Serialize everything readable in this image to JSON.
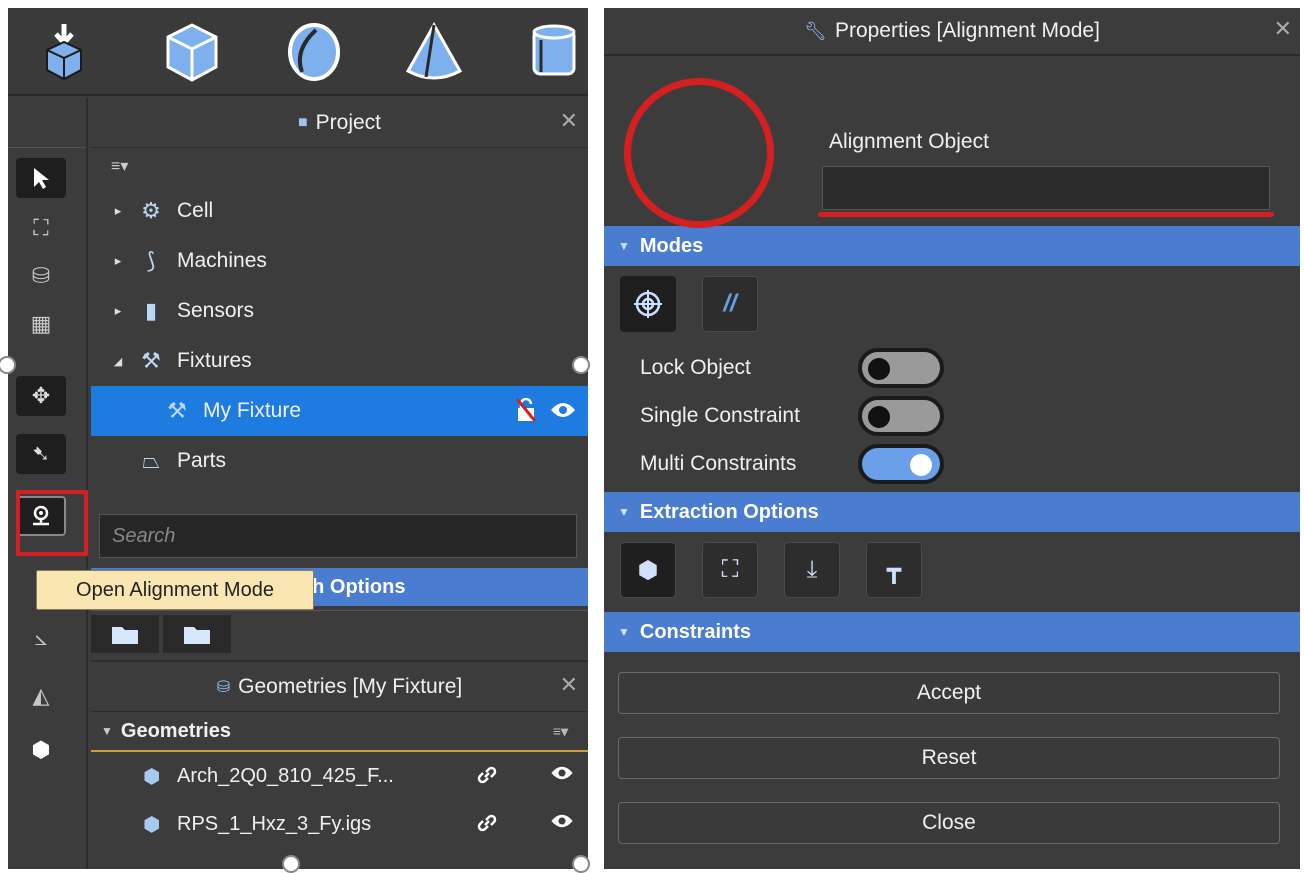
{
  "shape_toolbar": {
    "icons": [
      "import-part-icon",
      "box-icon",
      "sphere-icon",
      "cone-icon",
      "cylinder-icon"
    ]
  },
  "vertical_toolbar": {
    "icons": [
      "select-arrow-icon",
      "fixture-icon",
      "parts-stack-icon",
      "grid-icon",
      "robot-jog-icon",
      "robot-teach-icon",
      "alignment-pin-icon",
      "frame-icon",
      "measure-icon",
      "geometry-icon"
    ]
  },
  "project_panel": {
    "title": "Project",
    "menu": "≡▾",
    "tree": [
      {
        "label": "Cell",
        "caret": "▸",
        "icon": "cell-icon"
      },
      {
        "label": "Machines",
        "caret": "▸",
        "icon": "robot-arm-icon"
      },
      {
        "label": "Sensors",
        "caret": "▸",
        "icon": "sensor-icon"
      },
      {
        "label": "Fixtures",
        "caret": "◢",
        "icon": "fixture-icon"
      },
      {
        "label": "My Fixture",
        "caret": "",
        "icon": "fixture-icon",
        "selected": true
      },
      {
        "label": "Parts",
        "caret": "",
        "icon": "part-icon"
      }
    ],
    "search_placeholder": "Search",
    "batch_header": "Batch Options",
    "batch_header_visible": "ch Options"
  },
  "tooltip": {
    "text": "Open Alignment Mode"
  },
  "geometries_panel": {
    "title": "Geometries [My Fixture]",
    "section": "Geometries",
    "menu": "≡▾",
    "items": [
      {
        "name": "Arch_2Q0_810_425_F..."
      },
      {
        "name": "RPS_1_Hxz_3_Fy.igs"
      }
    ]
  },
  "properties_panel": {
    "title": "Properties [Alignment Mode]",
    "alignment_object_label": "Alignment Object",
    "alignment_object_value": "",
    "modes_section": "Modes",
    "toggles": [
      {
        "label": "Lock Object",
        "on": false
      },
      {
        "label": "Single Constraint",
        "on": false
      },
      {
        "label": "Multi Constraints",
        "on": true
      }
    ],
    "extraction_section": "Extraction Options",
    "constraints_section": "Constraints",
    "buttons": {
      "accept": "Accept",
      "reset": "Reset",
      "close": "Close"
    }
  },
  "colors": {
    "accent": "#4a7ccf",
    "selection": "#1e7be0",
    "highlight_red": "#d42020",
    "tooltip_bg": "#f9e6b3",
    "panel_bg": "#3c3c3c"
  }
}
